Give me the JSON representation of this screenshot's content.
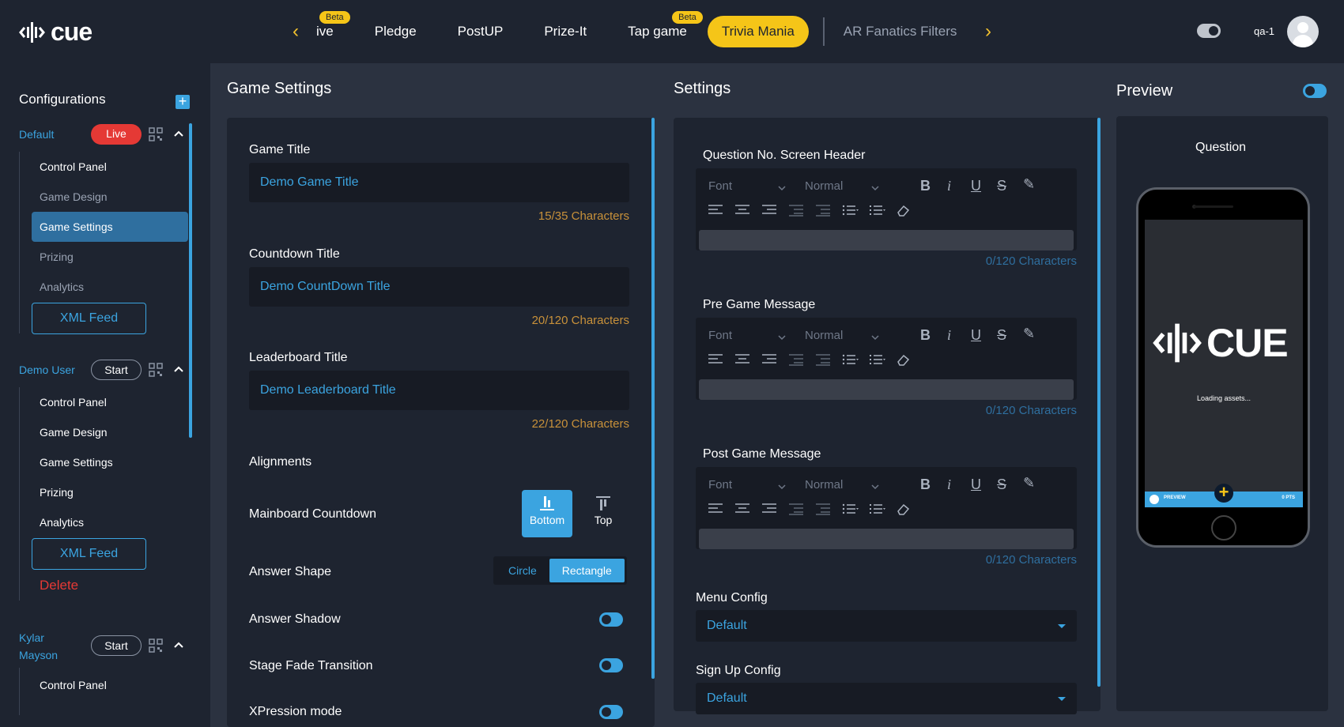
{
  "topbar": {
    "logo_text": "cue",
    "tabs": [
      {
        "label": "ive",
        "badge": "Beta"
      },
      {
        "label": "Pledge"
      },
      {
        "label": "PostUP"
      },
      {
        "label": "Prize-It"
      },
      {
        "label": "Tap game",
        "badge": "Beta"
      },
      {
        "label": "Trivia Mania",
        "active": true
      },
      {
        "label": "AR Fanatics Filters"
      }
    ],
    "user": "qa-1"
  },
  "sidebar": {
    "title": "Configurations",
    "configs": [
      {
        "name": "Default",
        "status": "Live",
        "items": [
          "Control Panel",
          "Game Design",
          "Game Settings",
          "Prizing",
          "Analytics"
        ],
        "xml": "XML Feed"
      },
      {
        "name": "Demo User",
        "status": "Start",
        "items": [
          "Control Panel",
          "Game Design",
          "Game Settings",
          "Prizing",
          "Analytics"
        ],
        "xml": "XML Feed",
        "delete": "Delete"
      },
      {
        "name_line1": "Kylar",
        "name_line2": "Mayson",
        "status": "Start",
        "items": [
          "Control Panel"
        ]
      }
    ]
  },
  "game_settings": {
    "heading": "Game Settings",
    "game_title": {
      "label": "Game Title",
      "value": "Demo Game Title",
      "counter": "15/35 Characters"
    },
    "countdown_title": {
      "label": "Countdown Title",
      "value": "Demo CountDown Title",
      "counter": "20/120 Characters"
    },
    "leaderboard_title": {
      "label": "Leaderboard Title",
      "value": "Demo Leaderboard Title",
      "counter": "22/120 Characters"
    },
    "alignments": "Alignments",
    "mainboard_countdown": {
      "label": "Mainboard Countdown",
      "options": [
        "Bottom",
        "Top"
      ],
      "selected": "Bottom"
    },
    "answer_shape": {
      "label": "Answer Shape",
      "options": [
        "Circle",
        "Rectangle"
      ],
      "selected": "Rectangle"
    },
    "answer_shadow": "Answer Shadow",
    "stage_fade": "Stage Fade Transition",
    "xpression": "XPression mode"
  },
  "settings": {
    "heading": "Settings",
    "editors": [
      {
        "label": "Question No. Screen Header",
        "counter": "0/120 Characters"
      },
      {
        "label": "Pre Game Message",
        "counter": "0/120 Characters"
      },
      {
        "label": "Post Game Message",
        "counter": "0/120 Characters"
      }
    ],
    "font_placeholder": "Font",
    "size_placeholder": "Normal",
    "menu_config": {
      "label": "Menu Config",
      "value": "Default"
    },
    "signup_config": {
      "label": "Sign Up Config",
      "value": "Default"
    }
  },
  "preview": {
    "heading": "Preview",
    "screen_label": "Question",
    "logo_text": "CUE",
    "loading": "Loading assets...",
    "bar_left": "PREVIEW",
    "bar_right": "0 PTS"
  },
  "colors": {
    "accent": "#3ba4e0",
    "gold": "#f5c518",
    "danger": "#e53935"
  }
}
